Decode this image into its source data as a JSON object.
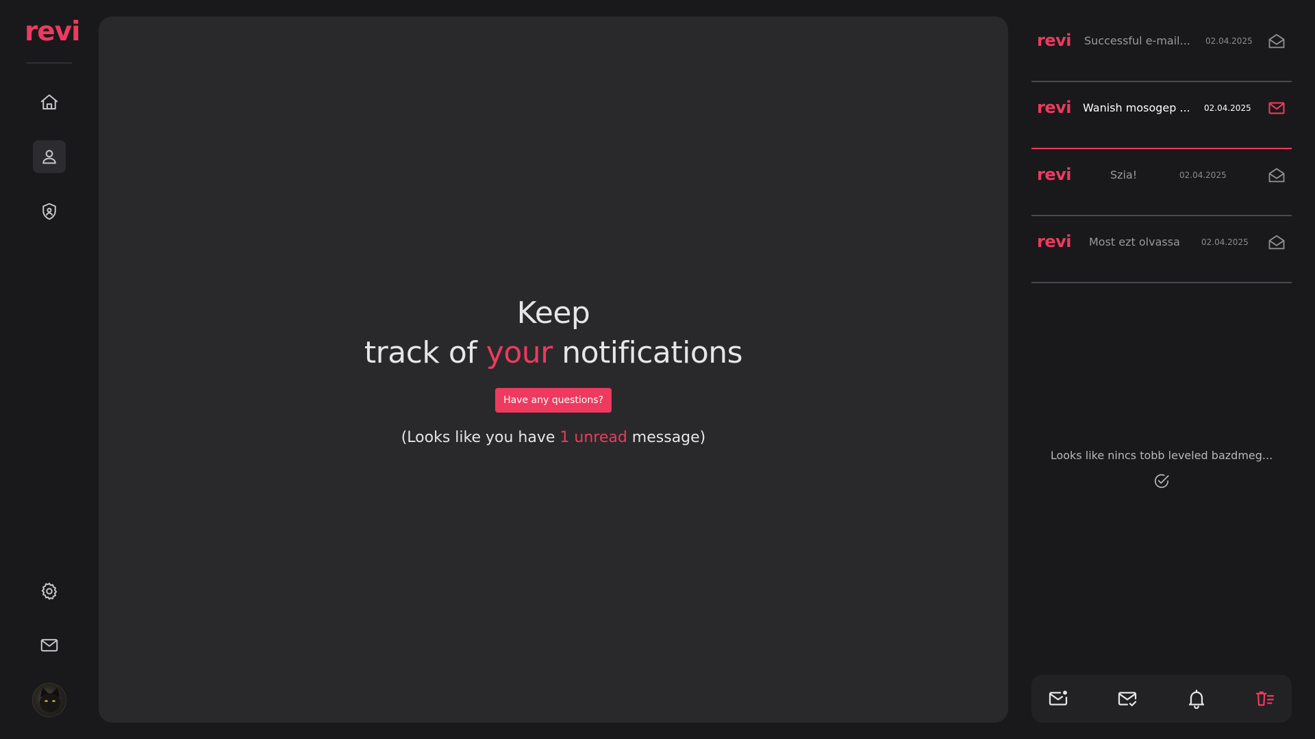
{
  "app": {
    "logo": "revi",
    "accent": "#ee3a5e"
  },
  "sidebar": {
    "items": [
      {
        "name": "home",
        "icon": "home-icon"
      },
      {
        "name": "profile",
        "icon": "user-icon",
        "active": true
      },
      {
        "name": "security",
        "icon": "shield-icon"
      },
      {
        "name": "settings",
        "icon": "gear-icon"
      },
      {
        "name": "mail",
        "icon": "mail-icon"
      }
    ],
    "avatar": "avatar"
  },
  "hero": {
    "line1": "Keep",
    "line2_pre": "track of ",
    "line2_accent": "your",
    "line2_post": " notifications",
    "button_label": "Have any questions?",
    "unread_pre": "(Looks like you have ",
    "unread_accent": "1 unread",
    "unread_post": " message)"
  },
  "notifications": [
    {
      "logo": "revi",
      "title": "Successful e-mail...",
      "date": "02.04.2025",
      "unread": false,
      "icon": "mail-open-icon"
    },
    {
      "logo": "revi",
      "title": "Wanish mosogep ...",
      "date": "02.04.2025",
      "unread": true,
      "icon": "mail-icon"
    },
    {
      "logo": "revi",
      "title": "Szia!",
      "date": "02.04.2025",
      "unread": false,
      "icon": "mail-open-icon"
    },
    {
      "logo": "revi",
      "title": "Most ezt olvassa",
      "date": "02.04.2025",
      "unread": false,
      "icon": "mail-open-icon"
    }
  ],
  "empty_state": {
    "text": "Looks like nincs tobb leveled bazdmeg...",
    "icon": "check-circle-icon"
  },
  "bottom_bar": [
    {
      "name": "unread-filter",
      "icon": "mail-dot-icon"
    },
    {
      "name": "read-filter",
      "icon": "mail-check-icon"
    },
    {
      "name": "notifications",
      "icon": "bell-icon"
    },
    {
      "name": "delete-all",
      "icon": "trash-list-icon",
      "accent": true
    }
  ]
}
